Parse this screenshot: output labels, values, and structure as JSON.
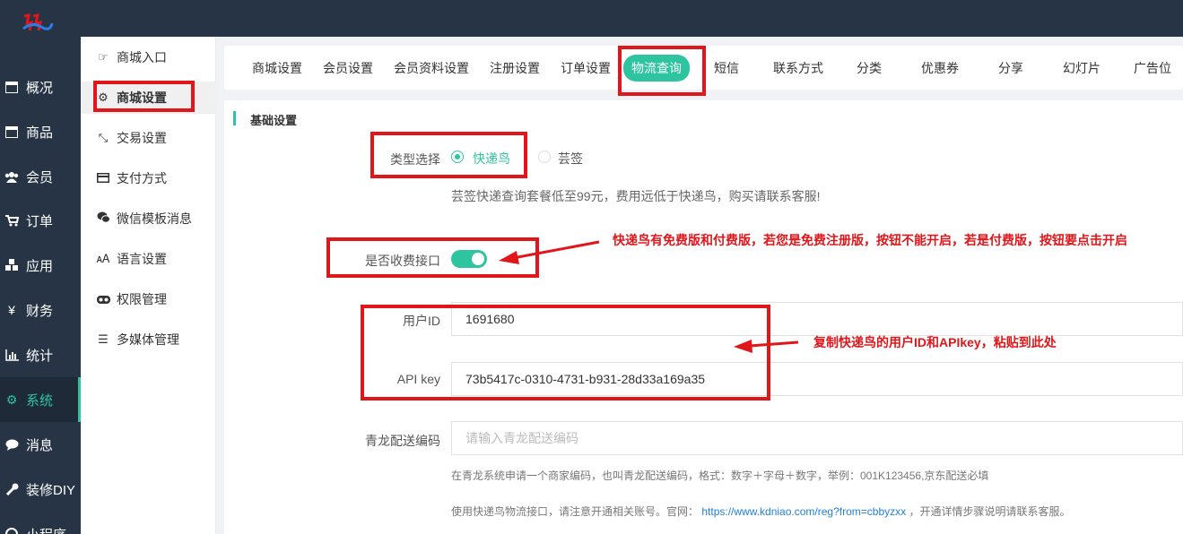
{
  "nav": {
    "items": [
      {
        "label": "概况",
        "icon": "dashboard-icon"
      },
      {
        "label": "商品",
        "icon": "goods-icon"
      },
      {
        "label": "会员",
        "icon": "members-icon"
      },
      {
        "label": "订单",
        "icon": "cart-icon"
      },
      {
        "label": "应用",
        "icon": "apps-icon"
      },
      {
        "label": "财务",
        "icon": "yen-icon"
      },
      {
        "label": "统计",
        "icon": "stats-icon"
      },
      {
        "label": "系统",
        "icon": "gear-icon",
        "active": true
      },
      {
        "label": "消息",
        "icon": "message-icon"
      },
      {
        "label": "装修DIY",
        "icon": "wrench-icon"
      },
      {
        "label": "小程序",
        "icon": "miniapp-icon"
      }
    ]
  },
  "submenu": {
    "items": [
      {
        "label": "商城入口",
        "icon": "entry-icon"
      },
      {
        "label": "商城设置",
        "icon": "gear-icon",
        "active": true
      },
      {
        "label": "交易设置",
        "icon": "trade-icon"
      },
      {
        "label": "支付方式",
        "icon": "card-icon"
      },
      {
        "label": "微信模板消息",
        "icon": "wechat-icon"
      },
      {
        "label": "语言设置",
        "icon": "language-icon"
      },
      {
        "label": "权限管理",
        "icon": "permission-icon"
      },
      {
        "label": "多媒体管理",
        "icon": "list-icon"
      }
    ]
  },
  "tabs": [
    {
      "label": "商城设置"
    },
    {
      "label": "会员设置"
    },
    {
      "label": "会员资料设置"
    },
    {
      "label": "注册设置"
    },
    {
      "label": "订单设置"
    },
    {
      "label": "物流查询",
      "active": true
    },
    {
      "label": "短信"
    },
    {
      "label": "联系方式"
    },
    {
      "label": "分类"
    },
    {
      "label": "优惠券"
    },
    {
      "label": "分享"
    },
    {
      "label": "幻灯片"
    },
    {
      "label": "广告位"
    }
  ],
  "form": {
    "section_title": "基础设置",
    "type_label": "类型选择",
    "type_options": [
      "快递鸟",
      "芸签"
    ],
    "type_selected": "快递鸟",
    "type_hint": "芸签快递查询套餐低至99元，费用远低于快递鸟，购买请联系客服!",
    "paid_label": "是否收费接口",
    "paid_on": true,
    "user_id_label": "用户ID",
    "user_id_value": "1691680",
    "api_key_label": "API key",
    "api_key_value": "73b5417c-0310-4731-b931-28d33a169a35",
    "qinglong_label": "青龙配送编码",
    "qinglong_placeholder": "请输入青龙配送编码",
    "qinglong_hint": "在青龙系统申请一个商家编码，也叫青龙配送编码，格式：数字＋字母＋数字，举例：001K123456,京东配送必填",
    "api_hint_prefix": "使用快递鸟物流接口，请注意开通相关账号。官网：",
    "api_hint_link": "https://www.kdniao.com/reg?from=cbbyzxx",
    "api_hint_suffix": "，开通详情步骤说明请联系客服。"
  },
  "annotations": {
    "note_paid": "快递鸟有免费版和付费版，若您是免费注册版，按钮不能开启，若是付费版，按钮要点击开启",
    "note_copy": "复制快递鸟的用户ID和APIkey，粘贴到此处"
  },
  "colors": {
    "sidebar_bg": "#263445",
    "accent": "#2ec4a0",
    "annotation_red": "#e0161b"
  }
}
